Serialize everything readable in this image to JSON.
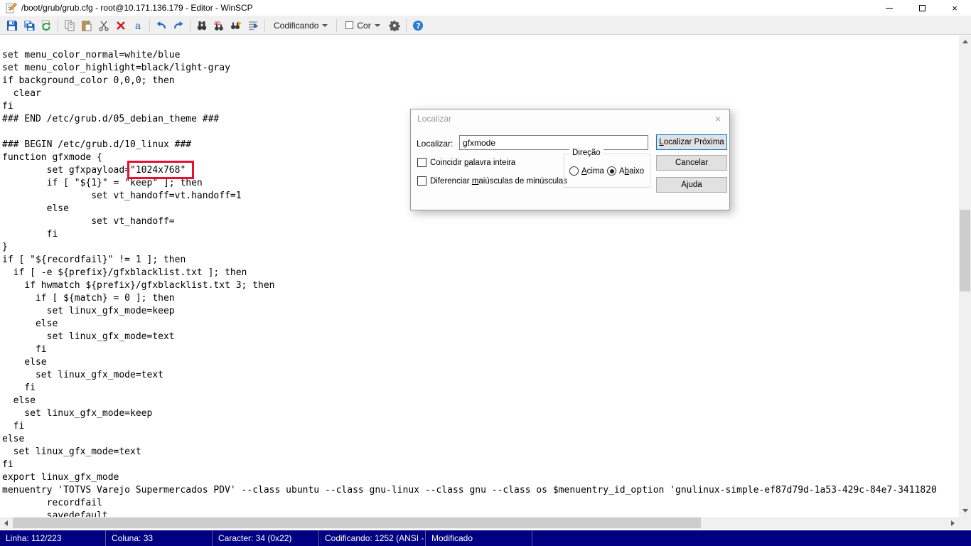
{
  "window": {
    "title": "/boot/grub/grub.cfg - root@10.171.136.179 - Editor - WinSCP",
    "close_glyph": "×"
  },
  "toolbar": {
    "codificando_label": "Codificando",
    "cor_label": "Cor",
    "icons": [
      "save",
      "save-all",
      "reload",
      "copy",
      "paste",
      "cut",
      "delete",
      "select-all",
      "undo",
      "redo",
      "find",
      "replace",
      "find-next",
      "goto-line",
      "encoding-dropdown",
      "color-dropdown",
      "preferences-gear",
      "help"
    ],
    "help_glyph": "?"
  },
  "editor": {
    "lines": [
      "set menu_color_normal=white/blue",
      "set menu_color_highlight=black/light-gray",
      "if background_color 0,0,0; then",
      "  clear",
      "fi",
      "### END /etc/grub.d/05_debian_theme ###",
      "",
      "### BEGIN /etc/grub.d/10_linux ###",
      "function gfxmode {",
      "        set gfxpayload=\"1024x768\"",
      "        if [ \"${1}\" = \"keep\" ]; then",
      "                set vt_handoff=vt.handoff=1",
      "        else",
      "                set vt_handoff=",
      "        fi",
      "}",
      "if [ \"${recordfail}\" != 1 ]; then",
      "  if [ -e ${prefix}/gfxblacklist.txt ]; then",
      "    if hwmatch ${prefix}/gfxblacklist.txt 3; then",
      "      if [ ${match} = 0 ]; then",
      "        set linux_gfx_mode=keep",
      "      else",
      "        set linux_gfx_mode=text",
      "      fi",
      "    else",
      "      set linux_gfx_mode=text",
      "    fi",
      "  else",
      "    set linux_gfx_mode=keep",
      "  fi",
      "else",
      "  set linux_gfx_mode=text",
      "fi",
      "export linux_gfx_mode",
      "menuentry 'TOTVS Varejo Supermercados PDV' --class ubuntu --class gnu-linux --class gnu --class os $menuentry_id_option 'gnulinux-simple-ef87d79d-1a53-429c-84e7-3411820",
      "        recordfail",
      "        savedefault"
    ],
    "annotation": {
      "highlighted_text": "\"1024x768\"",
      "box_color": "#e8112d"
    }
  },
  "find_dialog": {
    "title": "Localizar",
    "close_glyph": "×",
    "field_label": "Localizar:",
    "field_value": "gfxmode",
    "find_next_button": {
      "pre": "",
      "key": "L",
      "post": "ocalizar Próxima"
    },
    "cancel_button": "Cancelar",
    "help_button": "Ajuda",
    "whole_word_checkbox": {
      "pre": "Coincidir ",
      "key": "p",
      "post": "alavra inteira",
      "checked": false
    },
    "match_case_checkbox": {
      "pre": "Diferenciar ",
      "key": "m",
      "post": "aiúsculas de minúsculas",
      "checked": false
    },
    "direction_group": {
      "label": "Direção",
      "up": {
        "pre": "",
        "key": "A",
        "post": "cima",
        "selected": false
      },
      "down": {
        "pre": "A",
        "key": "b",
        "post": "aixo",
        "selected": true
      }
    }
  },
  "status_bar": {
    "segments": [
      "Linha: 112/223",
      "Coluna: 33",
      "Caracter: 34 (0x22)",
      "Codificando: 1252  (ANSI -",
      "Modificado"
    ],
    "background_color": "#000080"
  }
}
